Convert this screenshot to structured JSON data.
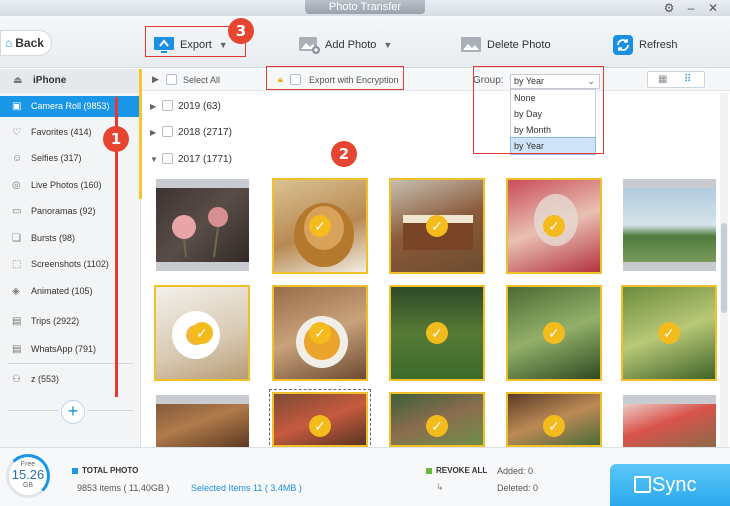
{
  "window": {
    "title": "Photo Transfer"
  },
  "toolbar": {
    "back_label": "Back",
    "export_label": "Export",
    "add_photo_label": "Add Photo",
    "delete_photo_label": "Delete Photo",
    "refresh_label": "Refresh"
  },
  "annotations": {
    "badge_1": "1",
    "badge_2": "2",
    "badge_3": "3"
  },
  "sidebar": {
    "device": "iPhone",
    "items": [
      {
        "label": "Camera Roll (9853)",
        "icon": "camera-icon",
        "active": true
      },
      {
        "label": "Favorites (414)",
        "icon": "heart-icon"
      },
      {
        "label": "Selfies (317)",
        "icon": "person-icon"
      },
      {
        "label": "Live Photos (160)",
        "icon": "live-photo-icon"
      },
      {
        "label": "Panoramas (92)",
        "icon": "panorama-icon"
      },
      {
        "label": "Bursts (98)",
        "icon": "bursts-icon"
      },
      {
        "label": "Screenshots (1102)",
        "icon": "screenshot-icon"
      },
      {
        "label": "Animated (105)",
        "icon": "animated-icon"
      },
      {
        "label": "Trips (2922)",
        "icon": "album-icon"
      },
      {
        "label": "WhatsApp (791)",
        "icon": "album-icon"
      },
      {
        "label": "z (553)",
        "icon": "shared-album-icon"
      }
    ]
  },
  "controls": {
    "select_all": "Select All",
    "export_encryption": "Export with Encryption",
    "group_label": "Group:",
    "group_value": "by Year",
    "group_options": [
      "None",
      "by Day",
      "by Month",
      "by Year"
    ]
  },
  "years": [
    {
      "label": "2019 (63)",
      "expanded": false
    },
    {
      "label": "2018 (2717)",
      "expanded": false
    },
    {
      "label": "2017 (1771)",
      "expanded": true
    }
  ],
  "footer": {
    "free_label": "Free",
    "free_value": "15.26",
    "free_unit": "GB",
    "total_photo_label": "TOTAL PHOTO",
    "items_text": "9853 items ( 11.40GB )",
    "selected_text": "Selected Items 11 ( 3.4MB )",
    "revoke_label": "REVOKE ALL",
    "added_text": "Added: 0",
    "deleted_text": "Deleted: 0",
    "sync_label": "Sync"
  },
  "colors": {
    "accent": "#1a96e8",
    "selection": "#f0c02a",
    "annotation": "#e53935"
  }
}
